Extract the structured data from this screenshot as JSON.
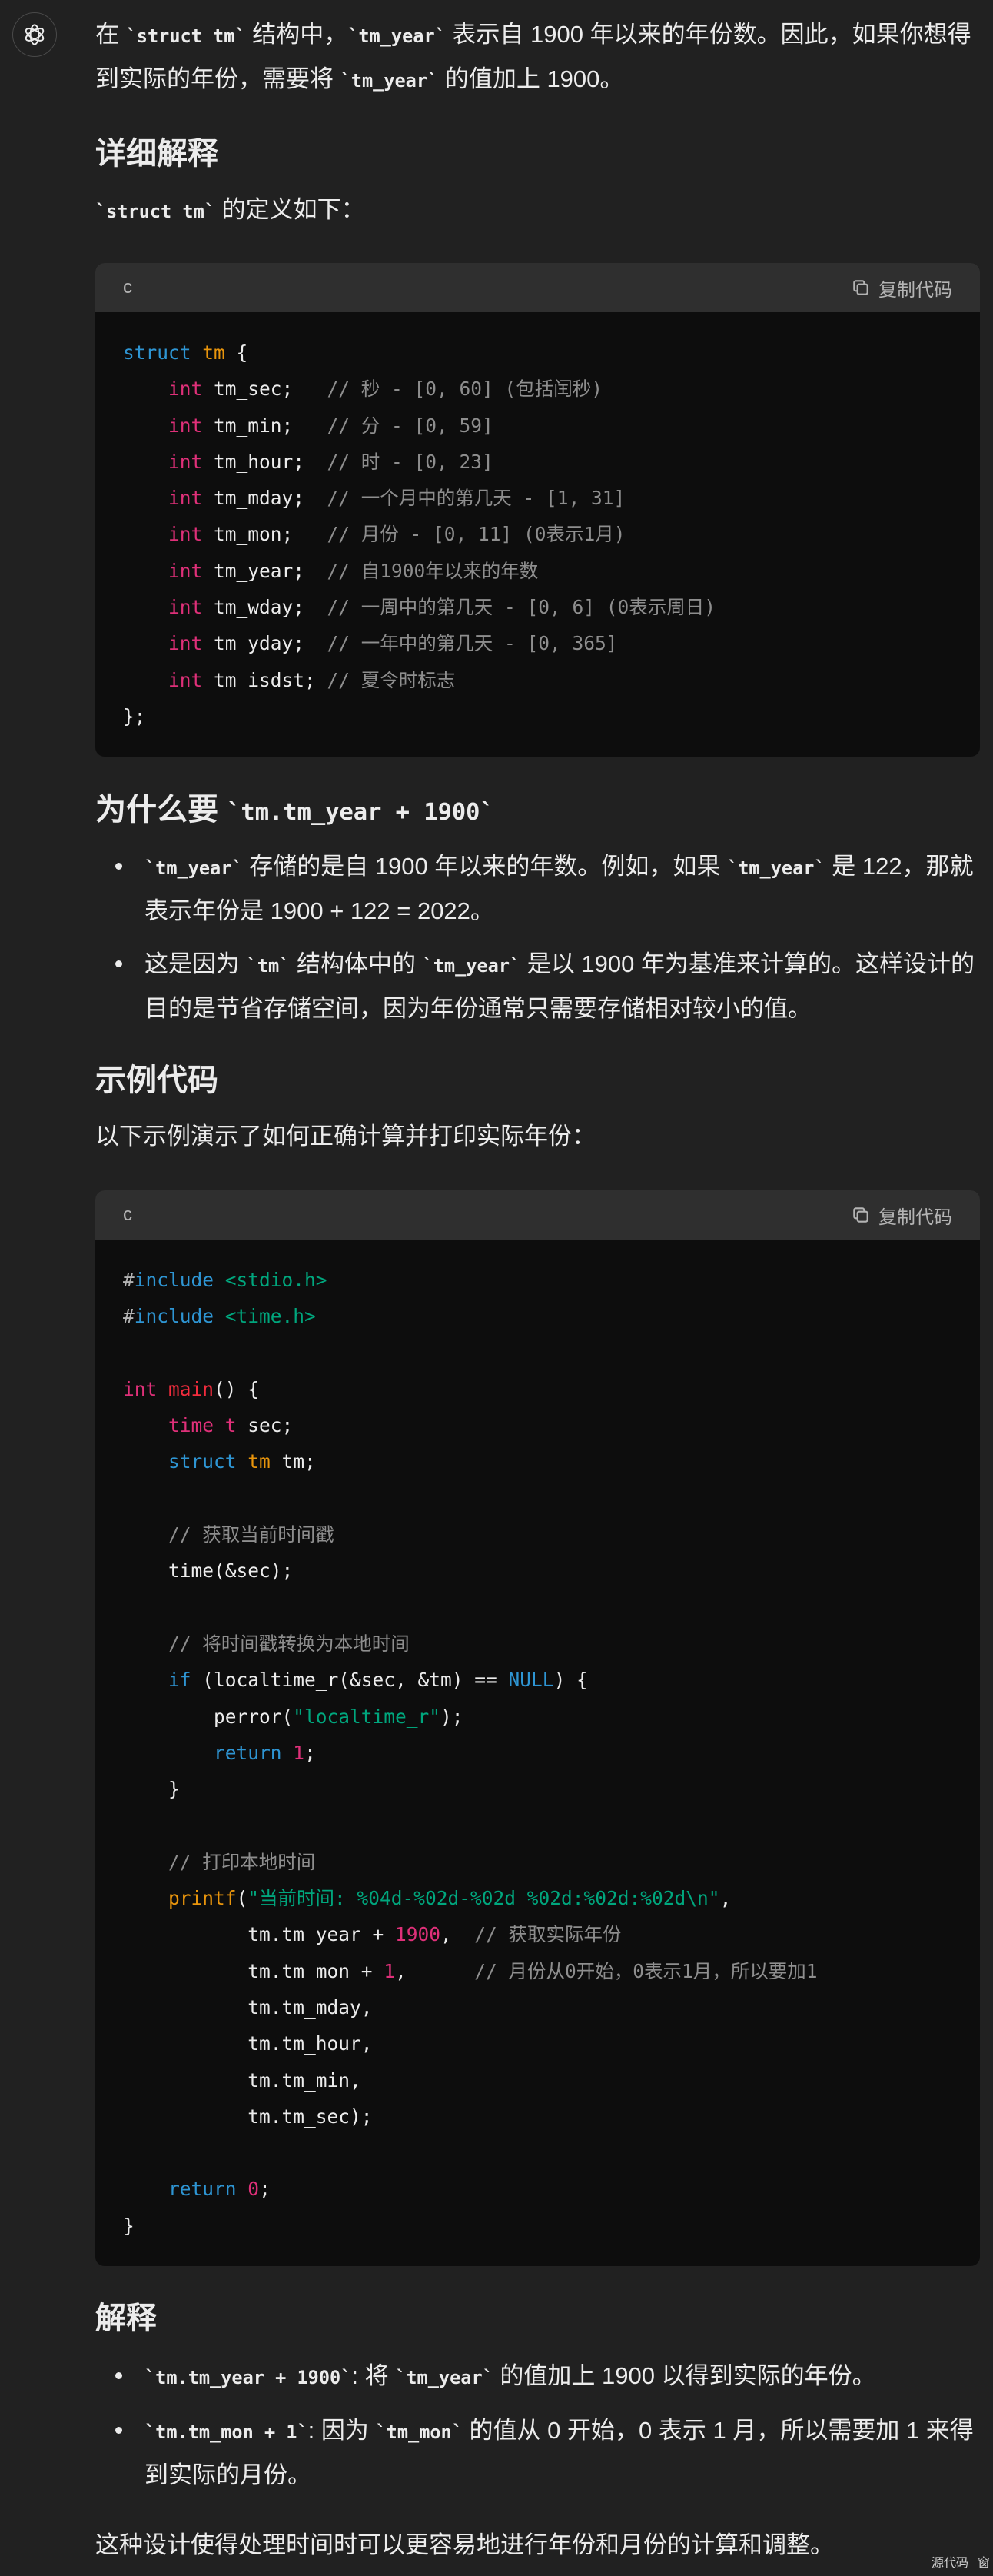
{
  "colors": {
    "background": "#212121",
    "text": "#ececec",
    "muted": "#b4b4b4",
    "code_background": "#0d0d0d",
    "code_header_background": "#2f2f2f",
    "syntax": {
      "keyword": "#2e95d3",
      "type": "#df3079",
      "title": "#f22c3d",
      "class": "#e9950c",
      "builtin": "#e9950c",
      "string": "#00a67d",
      "number": "#df3079",
      "comment": "#8e8e8e",
      "meta": "#b4b4b4"
    }
  },
  "icons": {
    "avatar": "openai-logo-icon",
    "copy": "copy-icon"
  },
  "content": {
    "intro": [
      {
        "text": "在 "
      },
      {
        "code": "`struct tm`"
      },
      {
        "text": " 结构中，"
      },
      {
        "code": "`tm_year`"
      },
      {
        "text": " 表示自 1900 年以来的年份数。因此，如果你想得到实际的年份，需要将 "
      },
      {
        "code": "`tm_year`"
      },
      {
        "text": " 的值加上 1900。"
      }
    ],
    "details_heading": "详细解释",
    "definition": [
      {
        "code": "`struct tm`"
      },
      {
        "text": " 的定义如下："
      }
    ],
    "code_struct": {
      "language": "c",
      "copy_label": "复制代码",
      "lines": [
        [
          {
            "text": "struct",
            "kind": "keyword"
          },
          {
            "text": " "
          },
          {
            "text": "tm",
            "kind": "class"
          },
          {
            "text": " {"
          }
        ],
        [
          {
            "text": "    "
          },
          {
            "text": "int",
            "kind": "type"
          },
          {
            "text": " tm_sec;   "
          },
          {
            "text": "// 秒 - [0, 60] (包括闰秒)",
            "kind": "comment"
          }
        ],
        [
          {
            "text": "    "
          },
          {
            "text": "int",
            "kind": "type"
          },
          {
            "text": " tm_min;   "
          },
          {
            "text": "// 分 - [0, 59]",
            "kind": "comment"
          }
        ],
        [
          {
            "text": "    "
          },
          {
            "text": "int",
            "kind": "type"
          },
          {
            "text": " tm_hour;  "
          },
          {
            "text": "// 时 - [0, 23]",
            "kind": "comment"
          }
        ],
        [
          {
            "text": "    "
          },
          {
            "text": "int",
            "kind": "type"
          },
          {
            "text": " tm_mday;  "
          },
          {
            "text": "// 一个月中的第几天 - [1, 31]",
            "kind": "comment"
          }
        ],
        [
          {
            "text": "    "
          },
          {
            "text": "int",
            "kind": "type"
          },
          {
            "text": " tm_mon;   "
          },
          {
            "text": "// 月份 - [0, 11] (0表示1月)",
            "kind": "comment"
          }
        ],
        [
          {
            "text": "    "
          },
          {
            "text": "int",
            "kind": "type"
          },
          {
            "text": " tm_year;  "
          },
          {
            "text": "// 自1900年以来的年数",
            "kind": "comment"
          }
        ],
        [
          {
            "text": "    "
          },
          {
            "text": "int",
            "kind": "type"
          },
          {
            "text": " tm_wday;  "
          },
          {
            "text": "// 一周中的第几天 - [0, 6] (0表示周日)",
            "kind": "comment"
          }
        ],
        [
          {
            "text": "    "
          },
          {
            "text": "int",
            "kind": "type"
          },
          {
            "text": " tm_yday;  "
          },
          {
            "text": "// 一年中的第几天 - [0, 365]",
            "kind": "comment"
          }
        ],
        [
          {
            "text": "    "
          },
          {
            "text": "int",
            "kind": "type"
          },
          {
            "text": " tm_isdst; "
          },
          {
            "text": "// 夏令时标志",
            "kind": "comment"
          }
        ],
        [
          {
            "text": "};"
          }
        ]
      ]
    },
    "why_heading": [
      {
        "text": "为什么要 "
      },
      {
        "code": "`tm.tm_year + 1900`"
      }
    ],
    "why_items": [
      [
        {
          "code": "`tm_year`"
        },
        {
          "text": " 存储的是自 1900 年以来的年数。例如，如果 "
        },
        {
          "code": "`tm_year`"
        },
        {
          "text": " 是 122，那就表示年份是 1900 + 122 = 2022。"
        }
      ],
      [
        {
          "text": "这是因为 "
        },
        {
          "code": "`tm`"
        },
        {
          "text": " 结构体中的 "
        },
        {
          "code": "`tm_year`"
        },
        {
          "text": " 是以 1900 年为基准来计算的。这样设计的目的是节省存储空间，因为年份通常只需要存储相对较小的值。"
        }
      ]
    ],
    "example_heading": "示例代码",
    "example_intro": "以下示例演示了如何正确计算并打印实际年份：",
    "code_example": {
      "language": "c",
      "copy_label": "复制代码",
      "lines": [
        [
          {
            "text": "#",
            "kind": "meta"
          },
          {
            "text": "include",
            "kind": "keyword"
          },
          {
            "text": " "
          },
          {
            "text": "<stdio.h>",
            "kind": "string"
          }
        ],
        [
          {
            "text": "#",
            "kind": "meta"
          },
          {
            "text": "include",
            "kind": "keyword"
          },
          {
            "text": " "
          },
          {
            "text": "<time.h>",
            "kind": "string"
          }
        ],
        [],
        [
          {
            "text": "int",
            "kind": "type"
          },
          {
            "text": " "
          },
          {
            "text": "main",
            "kind": "title"
          },
          {
            "text": "() {"
          }
        ],
        [
          {
            "text": "    "
          },
          {
            "text": "time_t",
            "kind": "type"
          },
          {
            "text": " sec;"
          }
        ],
        [
          {
            "text": "    "
          },
          {
            "text": "struct",
            "kind": "keyword"
          },
          {
            "text": " "
          },
          {
            "text": "tm",
            "kind": "class"
          },
          {
            "text": " tm;"
          }
        ],
        [],
        [
          {
            "text": "    "
          },
          {
            "text": "// 获取当前时间戳",
            "kind": "comment"
          }
        ],
        [
          {
            "text": "    time(&sec);"
          }
        ],
        [],
        [
          {
            "text": "    "
          },
          {
            "text": "// 将时间戳转换为本地时间",
            "kind": "comment"
          }
        ],
        [
          {
            "text": "    "
          },
          {
            "text": "if",
            "kind": "keyword"
          },
          {
            "text": " (localtime_r(&sec, &tm) == "
          },
          {
            "text": "NULL",
            "kind": "keyword"
          },
          {
            "text": ") {"
          }
        ],
        [
          {
            "text": "        perror("
          },
          {
            "text": "\"localtime_r\"",
            "kind": "string"
          },
          {
            "text": ");"
          }
        ],
        [
          {
            "text": "        "
          },
          {
            "text": "return",
            "kind": "keyword"
          },
          {
            "text": " "
          },
          {
            "text": "1",
            "kind": "number"
          },
          {
            "text": ";"
          }
        ],
        [
          {
            "text": "    }"
          }
        ],
        [],
        [
          {
            "text": "    "
          },
          {
            "text": "// 打印本地时间",
            "kind": "comment"
          }
        ],
        [
          {
            "text": "    "
          },
          {
            "text": "printf",
            "kind": "builtin"
          },
          {
            "text": "("
          },
          {
            "text": "\"当前时间: %04d-%02d-%02d %02d:%02d:%02d\\n\"",
            "kind": "string"
          },
          {
            "text": ","
          }
        ],
        [
          {
            "text": "           tm.tm_year + "
          },
          {
            "text": "1900",
            "kind": "number"
          },
          {
            "text": ",  "
          },
          {
            "text": "// 获取实际年份",
            "kind": "comment"
          }
        ],
        [
          {
            "text": "           tm.tm_mon + "
          },
          {
            "text": "1",
            "kind": "number"
          },
          {
            "text": ",      "
          },
          {
            "text": "// 月份从0开始，0表示1月，所以要加1",
            "kind": "comment"
          }
        ],
        [
          {
            "text": "           tm.tm_mday,"
          }
        ],
        [
          {
            "text": "           tm.tm_hour,"
          }
        ],
        [
          {
            "text": "           tm.tm_min,"
          }
        ],
        [
          {
            "text": "           tm.tm_sec);"
          }
        ],
        [],
        [
          {
            "text": "    "
          },
          {
            "text": "return",
            "kind": "keyword"
          },
          {
            "text": " "
          },
          {
            "text": "0",
            "kind": "number"
          },
          {
            "text": ";"
          }
        ],
        [
          {
            "text": "}"
          }
        ]
      ]
    },
    "explain_heading": "解释",
    "explain_items": [
      [
        {
          "code": "`tm.tm_year + 1900`"
        },
        {
          "text": ": 将 "
        },
        {
          "code": "`tm_year`"
        },
        {
          "text": " 的值加上 1900 以得到实际的年份。"
        }
      ],
      [
        {
          "code": "`tm.tm_mon + 1`"
        },
        {
          "text": ": 因为 "
        },
        {
          "code": "`tm_mon`"
        },
        {
          "text": " 的值从 0 开始，0 表示 1 月，所以需要加 1 来得到实际的月份。"
        }
      ]
    ],
    "closing": "这种设计使得处理时间时可以更容易地进行年份和月份的计算和调整。"
  },
  "overlay": {
    "source_label": "源代码",
    "window_label": "窗"
  }
}
